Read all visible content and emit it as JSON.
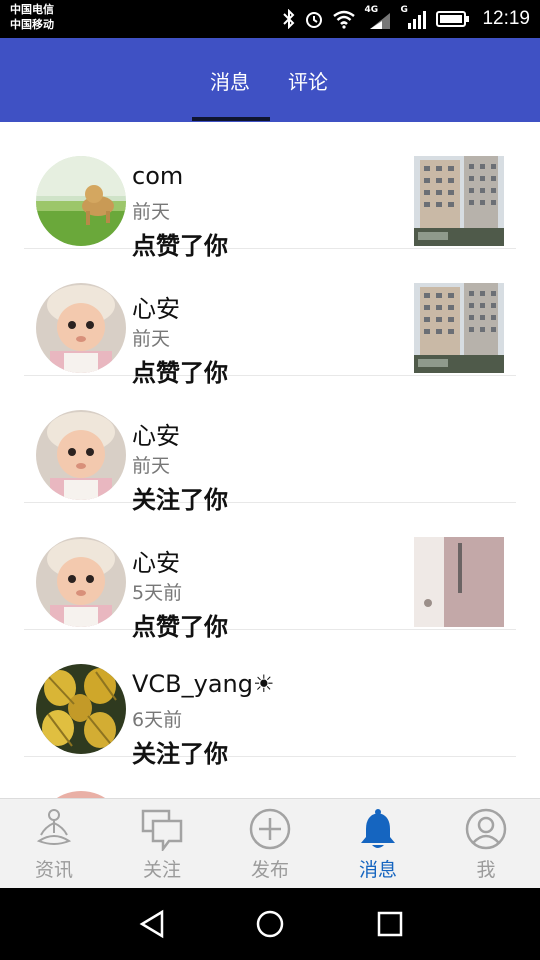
{
  "status_bar": {
    "carrier_1": "中国电信",
    "carrier_2": "中国移动",
    "net_1": "4G",
    "net_2": "G",
    "time": "12:19",
    "icons": [
      "bluetooth-icon",
      "alarm-icon",
      "wifi-icon",
      "signal-icon",
      "signal-icon",
      "battery-icon"
    ]
  },
  "tabs": [
    {
      "label": "消息",
      "active": true
    },
    {
      "label": "评论",
      "active": false
    }
  ],
  "messages": [
    {
      "name": "com",
      "time": "前天",
      "action": "点赞了你",
      "avatar": "dog-photo",
      "has_thumbnail": true,
      "thumbnail": "building-photo"
    },
    {
      "name": "心安",
      "time": "前天",
      "action": "点赞了你",
      "avatar": "baby-photo",
      "has_thumbnail": true,
      "thumbnail": "building-photo"
    },
    {
      "name": "心安",
      "time": "前天",
      "action": "关注了你",
      "avatar": "baby-photo",
      "has_thumbnail": false
    },
    {
      "name": "心安",
      "time": "5天前",
      "action": "点赞了你",
      "avatar": "baby-photo",
      "has_thumbnail": true,
      "thumbnail": "door-photo"
    },
    {
      "name": "VCB_yang☀",
      "time": "6天前",
      "action": "关注了你",
      "avatar": "pineapple-photo",
      "has_thumbnail": false
    }
  ],
  "bottom_nav": [
    {
      "label": "资讯",
      "icon": "meditation-icon",
      "active": false
    },
    {
      "label": "关注",
      "icon": "chat-icon",
      "active": false
    },
    {
      "label": "发布",
      "icon": "plus-circle-icon",
      "active": false
    },
    {
      "label": "消息",
      "icon": "bell-icon",
      "active": true
    },
    {
      "label": "我",
      "icon": "user-icon",
      "active": false
    }
  ],
  "colors": {
    "app_bar": "#3f51c4",
    "active_nav": "#1565c0",
    "inactive_nav": "#9b9b9b"
  }
}
